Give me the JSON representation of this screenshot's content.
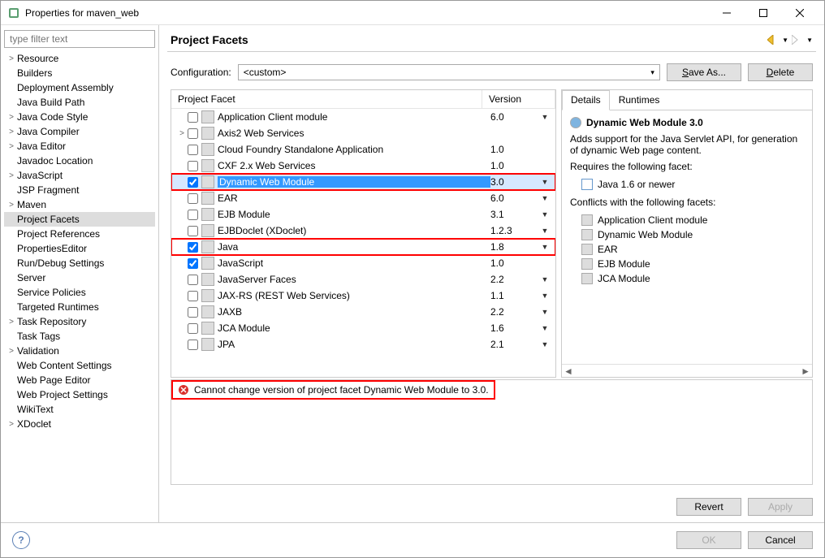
{
  "window": {
    "title": "Properties for maven_web"
  },
  "filter_placeholder": "type filter text",
  "tree": [
    {
      "label": "Resource",
      "exp": ">"
    },
    {
      "label": "Builders",
      "exp": ""
    },
    {
      "label": "Deployment Assembly",
      "exp": ""
    },
    {
      "label": "Java Build Path",
      "exp": ""
    },
    {
      "label": "Java Code Style",
      "exp": ">"
    },
    {
      "label": "Java Compiler",
      "exp": ">"
    },
    {
      "label": "Java Editor",
      "exp": ">"
    },
    {
      "label": "Javadoc Location",
      "exp": ""
    },
    {
      "label": "JavaScript",
      "exp": ">"
    },
    {
      "label": "JSP Fragment",
      "exp": ""
    },
    {
      "label": "Maven",
      "exp": ">"
    },
    {
      "label": "Project Facets",
      "exp": "",
      "selected": true
    },
    {
      "label": "Project References",
      "exp": ""
    },
    {
      "label": "PropertiesEditor",
      "exp": ""
    },
    {
      "label": "Run/Debug Settings",
      "exp": ""
    },
    {
      "label": "Server",
      "exp": ""
    },
    {
      "label": "Service Policies",
      "exp": ""
    },
    {
      "label": "Targeted Runtimes",
      "exp": ""
    },
    {
      "label": "Task Repository",
      "exp": ">"
    },
    {
      "label": "Task Tags",
      "exp": ""
    },
    {
      "label": "Validation",
      "exp": ">"
    },
    {
      "label": "Web Content Settings",
      "exp": ""
    },
    {
      "label": "Web Page Editor",
      "exp": ""
    },
    {
      "label": "Web Project Settings",
      "exp": ""
    },
    {
      "label": "WikiText",
      "exp": ""
    },
    {
      "label": "XDoclet",
      "exp": ">"
    }
  ],
  "page_title": "Project Facets",
  "config_label": "Configuration:",
  "config_value": "<custom>",
  "save_as_label": "Save As...",
  "delete_label": "Delete",
  "columns": {
    "facet": "Project Facet",
    "version": "Version"
  },
  "facets": [
    {
      "exp": "",
      "checked": false,
      "name": "Application Client module",
      "ver": "6.0",
      "drop": true,
      "icon": "app"
    },
    {
      "exp": ">",
      "checked": false,
      "name": "Axis2 Web Services",
      "ver": "",
      "drop": false,
      "icon": "axis"
    },
    {
      "exp": "",
      "checked": false,
      "name": "Cloud Foundry Standalone Application",
      "ver": "1.0",
      "drop": false,
      "icon": "cloud"
    },
    {
      "exp": "",
      "checked": false,
      "name": "CXF 2.x Web Services",
      "ver": "1.0",
      "drop": false,
      "icon": "cxf"
    },
    {
      "exp": "",
      "checked": true,
      "name": "Dynamic Web Module",
      "ver": "3.0",
      "drop": true,
      "icon": "dwm",
      "hl": true,
      "red": true
    },
    {
      "exp": "",
      "checked": false,
      "name": "EAR",
      "ver": "6.0",
      "drop": true,
      "icon": "ear"
    },
    {
      "exp": "",
      "checked": false,
      "name": "EJB Module",
      "ver": "3.1",
      "drop": true,
      "icon": "ejb"
    },
    {
      "exp": "",
      "checked": false,
      "name": "EJBDoclet (XDoclet)",
      "ver": "1.2.3",
      "drop": true,
      "icon": "ejbd"
    },
    {
      "exp": "",
      "checked": true,
      "name": "Java",
      "ver": "1.8",
      "drop": true,
      "icon": "java",
      "red": true
    },
    {
      "exp": "",
      "checked": true,
      "name": "JavaScript",
      "ver": "1.0",
      "drop": false,
      "icon": "js"
    },
    {
      "exp": "",
      "checked": false,
      "name": "JavaServer Faces",
      "ver": "2.2",
      "drop": true,
      "icon": "jsf"
    },
    {
      "exp": "",
      "checked": false,
      "name": "JAX-RS (REST Web Services)",
      "ver": "1.1",
      "drop": true,
      "icon": "jax"
    },
    {
      "exp": "",
      "checked": false,
      "name": "JAXB",
      "ver": "2.2",
      "drop": true,
      "icon": "jaxb"
    },
    {
      "exp": "",
      "checked": false,
      "name": "JCA Module",
      "ver": "1.6",
      "drop": true,
      "icon": "jca"
    },
    {
      "exp": "",
      "checked": false,
      "name": "JPA",
      "ver": "2.1",
      "drop": true,
      "icon": "jpa"
    }
  ],
  "tabs": {
    "details": "Details",
    "runtimes": "Runtimes"
  },
  "details": {
    "title": "Dynamic Web Module 3.0",
    "desc": "Adds support for the Java Servlet API, for generation of dynamic Web page content.",
    "requires_label": "Requires the following facet:",
    "requires": [
      "Java 1.6 or newer"
    ],
    "conflicts_label": "Conflicts with the following facets:",
    "conflicts": [
      "Application Client module",
      "Dynamic Web Module",
      "EAR",
      "EJB Module",
      "JCA Module"
    ]
  },
  "error_text": "Cannot change version of project facet Dynamic Web Module to 3.0.",
  "revert_label": "Revert",
  "apply_label": "Apply",
  "ok_label": "OK",
  "cancel_label": "Cancel"
}
